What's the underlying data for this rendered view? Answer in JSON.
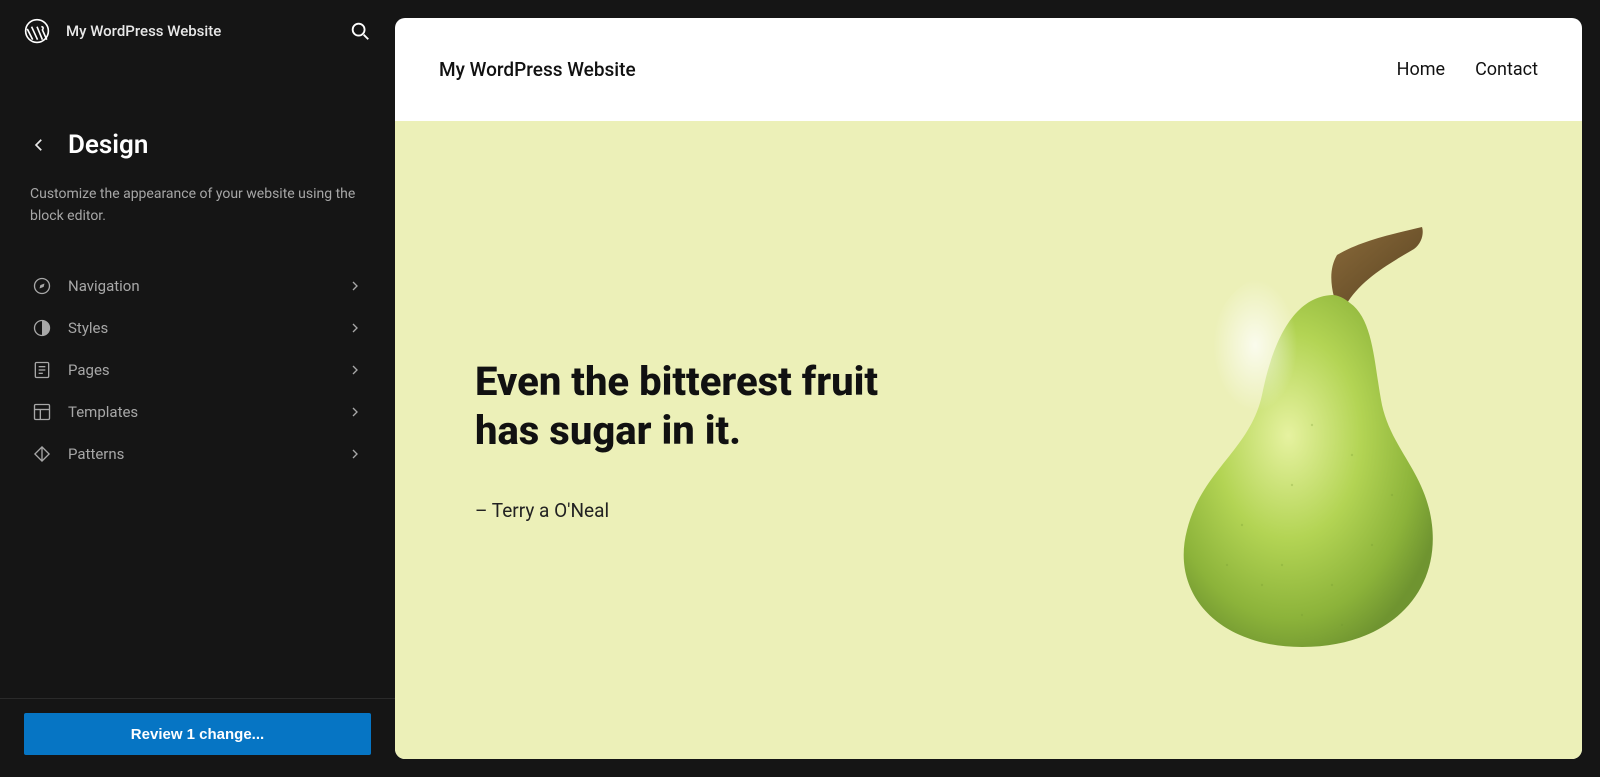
{
  "topbar": {
    "site_name": "My WordPress Website"
  },
  "panel": {
    "title": "Design",
    "description": "Customize the appearance of your website using the block editor."
  },
  "navigation": {
    "items": [
      {
        "label": "Navigation"
      },
      {
        "label": "Styles"
      },
      {
        "label": "Pages"
      },
      {
        "label": "Templates"
      },
      {
        "label": "Patterns"
      }
    ]
  },
  "footer": {
    "review_button": "Review 1 change..."
  },
  "preview": {
    "site_title": "My WordPress Website",
    "nav": [
      {
        "label": "Home"
      },
      {
        "label": "Contact"
      }
    ],
    "hero": {
      "quote_line1": "Even the bitterest fruit",
      "quote_line2": "has sugar in it.",
      "attribution": "– Terry a O'Neal"
    }
  },
  "colors": {
    "sidebar_bg": "#151515",
    "action_blue": "#0675c4",
    "hero_bg": "#ecf0b8"
  }
}
